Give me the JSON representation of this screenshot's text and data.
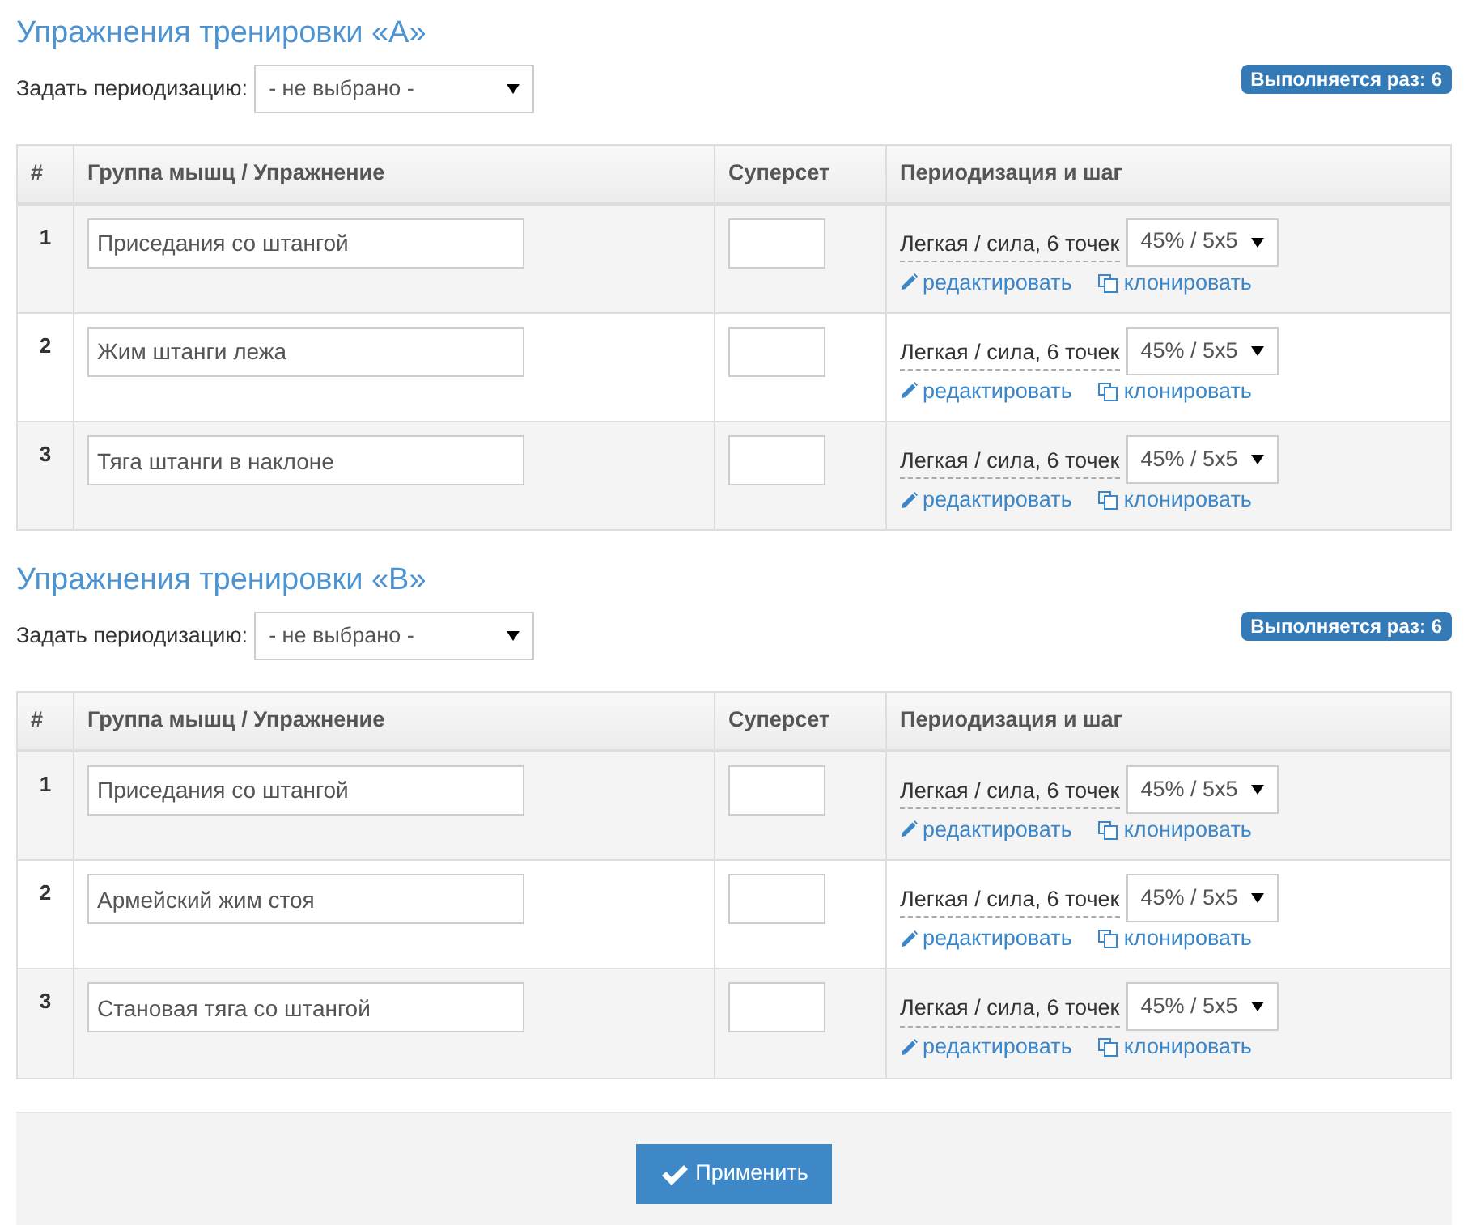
{
  "sections": [
    {
      "title": "Упражнения тренировки «A»",
      "periodization_label": "Задать периодизацию:",
      "periodization_select": "- не выбрано -",
      "runs_badge": "Выполняется раз: 6",
      "columns": [
        "#",
        "Группа мышц / Упражнение",
        "Суперсет",
        "Периодизация и шаг"
      ],
      "rows": [
        {
          "number": "1",
          "exercise": "Приседания со штангой",
          "period_label": "Легкая / сила, 6 точек",
          "step_select": "45% / 5x5",
          "edit_link": "редактировать",
          "clone_link": "клонировать"
        },
        {
          "number": "2",
          "exercise": "Жим штанги лежа",
          "period_label": "Легкая / сила, 6 точек",
          "step_select": "45% / 5x5",
          "edit_link": "редактировать",
          "clone_link": "клонировать"
        },
        {
          "number": "3",
          "exercise": "Тяга штанги в наклоне",
          "period_label": "Легкая / сила, 6 точек",
          "step_select": "45% / 5x5",
          "edit_link": "редактировать",
          "clone_link": "клонировать"
        }
      ]
    },
    {
      "title": "Упражнения тренировки «B»",
      "periodization_label": "Задать периодизацию:",
      "periodization_select": "- не выбрано -",
      "runs_badge": "Выполняется раз: 6",
      "columns": [
        "#",
        "Группа мышц / Упражнение",
        "Суперсет",
        "Периодизация и шаг"
      ],
      "rows": [
        {
          "number": "1",
          "exercise": "Приседания со штангой",
          "period_label": "Легкая / сила, 6 точек",
          "step_select": "45% / 5x5",
          "edit_link": "редактировать",
          "clone_link": "клонировать"
        },
        {
          "number": "2",
          "exercise": "Армейский жим стоя",
          "period_label": "Легкая / сила, 6 точек",
          "step_select": "45% / 5x5",
          "edit_link": "редактировать",
          "clone_link": "клонировать"
        },
        {
          "number": "3",
          "exercise": "Становая тяга со штангой",
          "period_label": "Легкая / сила, 6 точек",
          "step_select": "45% / 5x5",
          "edit_link": "редактировать",
          "clone_link": "клонировать"
        }
      ]
    }
  ],
  "apply_button": "Применить"
}
